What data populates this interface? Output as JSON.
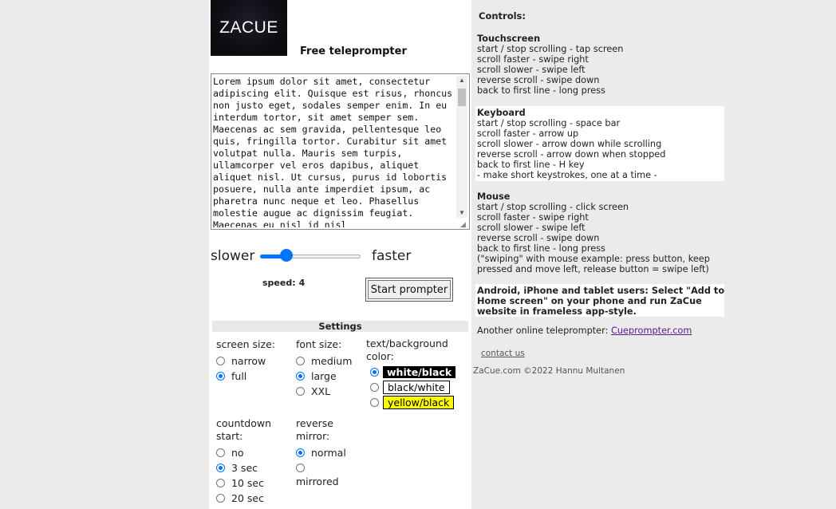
{
  "logo_text": "ZACUE",
  "subtitle": "Free teleprompter",
  "script_text": "Lorem ipsum dolor sit amet, consectetur adipiscing elit. Quisque est risus, rhoncus non justo eget, sodales semper enim. In eu interdum tortor, sit amet semper sem. Maecenas ac sem gravida, pellentesque leo quis, fringilla tortor. Curabitur sit amet volutpat nulla. Mauris sem turpis, ullamcorper vel eros dapibus, aliquet aliquet nisl. Ut cursus, purus id lobortis posuere, nulla ante imperdiet ipsum, ac pharetra nunc neque et leo. Phasellus molestie augue ac dignissim feugiat. Maecenas eu nisl id nisl",
  "speed_slider": {
    "label_slow": "slower",
    "label_fast": "faster",
    "value_fraction": 0.23
  },
  "speed": {
    "label": "speed:",
    "value": "4"
  },
  "start_button": "Start prompter",
  "settings": {
    "title": "Settings",
    "screen_size": {
      "title": "screen size:",
      "options": [
        "narrow",
        "full"
      ],
      "selected": 1
    },
    "font_size": {
      "title": "font size:",
      "options": [
        "medium",
        "large",
        "XXL"
      ],
      "selected": 1
    },
    "colors": {
      "title": "text/background color:",
      "options": [
        "white/black",
        "black/white",
        "yellow/black"
      ],
      "selected": 0
    },
    "countdown": {
      "title": "countdown start:",
      "options": [
        "no",
        "3 sec",
        "10 sec",
        "20 sec"
      ],
      "selected": 1
    },
    "mirror": {
      "title": "reverse mirror:",
      "options": [
        "normal",
        "mirrored"
      ],
      "selected": 0
    }
  },
  "controls": {
    "title": "Controls:",
    "touchscreen": {
      "title": "Touchscreen",
      "lines": [
        "start / stop scrolling - tap screen",
        "scroll faster - swipe right",
        "scroll slower - swipe left",
        "reverse scroll - swipe down",
        "back to first line - long press"
      ]
    },
    "keyboard": {
      "title": "Keyboard",
      "lines": [
        "start / stop scrolling - space bar",
        "scroll faster - arrow up",
        "scroll slower - arrow down while scrolling",
        "reverse scroll - arrow down when stopped",
        "back to first line - H key",
        "- make short keystrokes, one at a time -"
      ]
    },
    "mouse": {
      "title": "Mouse",
      "lines": [
        "start / stop scrolling - click screen",
        "scroll faster - swipe right",
        "scroll slower - swipe left",
        "reverse scroll - swipe down",
        "back to first line - long press",
        "(\"swiping\" with mouse example: press button, keep",
        "pressed and move left, release button = swipe left)"
      ]
    },
    "app_note_lines": [
      "Android, iPhone and tablet users: Select \"Add to",
      "Home screen\" on your phone and run ZaCue",
      "website in frameless app-style."
    ],
    "other_label": "Another online teleprompter:",
    "other_link": "Cueprompter.com",
    "contact": "contact us",
    "footer": "ZaCue.com ©2022 Hannu Multanen"
  }
}
